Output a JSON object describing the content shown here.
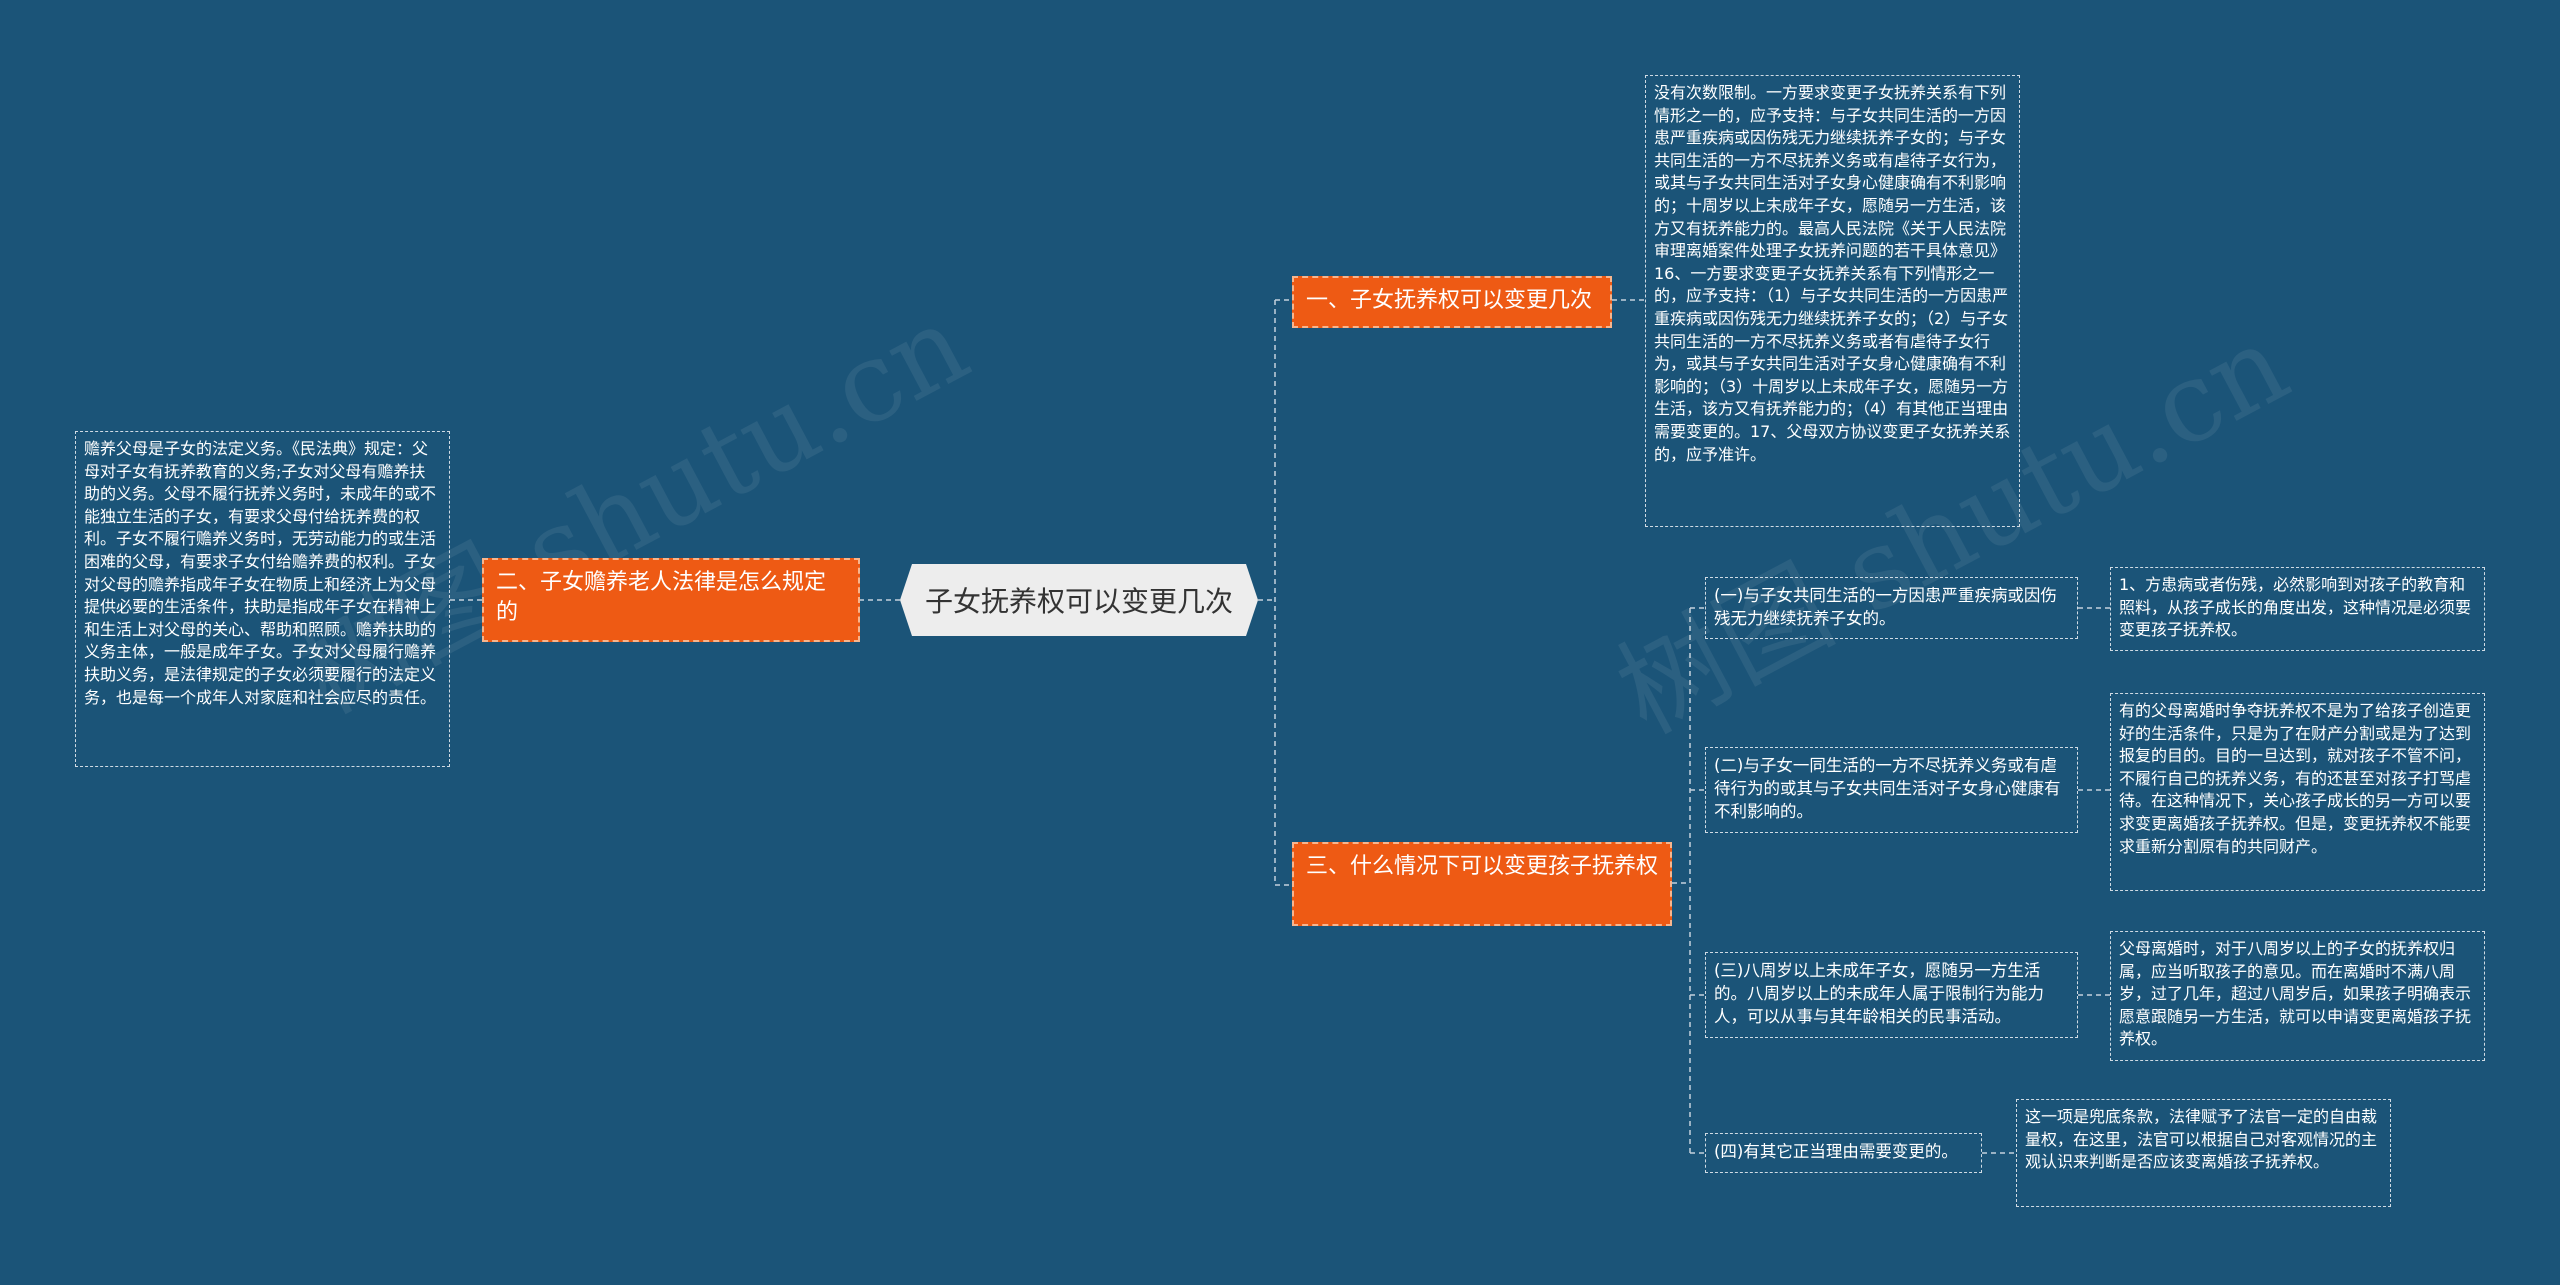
{
  "watermarks": [
    "树图 shutu.cn",
    "树图 shutu.cn"
  ],
  "root": {
    "label": "子女抚养权可以变更几次"
  },
  "left_branch": {
    "label": "二、子女赡养老人法律是怎么规定的",
    "detail": "赡养父母是子女的法定义务。《民法典》规定：父母对子女有抚养教育的义务;子女对父母有赡养扶助的义务。父母不履行抚养义务时，未成年的或不能独立生活的子女，有要求父母付给抚养费的权利。子女不履行赡养义务时，无劳动能力的或生活困难的父母，有要求子女付给赡养费的权利。子女对父母的赡养指成年子女在物质上和经济上为父母提供必要的生活条件，扶助是指成年子女在精神上和生活上对父母的关心、帮助和照顾。赡养扶助的义务主体，一般是成年子女。子女对父母履行赡养扶助义务，是法律规定的子女必须要履行的法定义务，也是每一个成年人对家庭和社会应尽的责任。"
  },
  "branch1": {
    "label": "一、子女抚养权可以变更几次",
    "detail": "没有次数限制。一方要求变更子女抚养关系有下列情形之一的，应予支持：与子女共同生活的一方因患严重疾病或因伤残无力继续抚养子女的；与子女共同生活的一方不尽抚养义务或有虐待子女行为，或其与子女共同生活对子女身心健康确有不利影响的；十周岁以上未成年子女，愿随另一方生活，该方又有抚养能力的。最高人民法院《关于人民法院审理离婚案件处理子女抚养问题的若干具体意见》16、一方要求变更子女抚养关系有下列情形之一的，应予支持：（1）与子女共同生活的一方因患严重疾病或因伤残无力继续抚养子女的；（2）与子女共同生活的一方不尽抚养义务或者有虐待子女行为，或其与子女共同生活对子女身心健康确有不利影响的；（3）十周岁以上未成年子女，愿随另一方生活，该方又有抚养能力的；（4）有其他正当理由需要变更的。17、父母双方协议变更子女抚养关系的，应予准许。"
  },
  "branch3": {
    "label": "三、什么情况下可以变更孩子抚养权",
    "items": [
      {
        "label": "(一)与子女共同生活的一方因患严重疾病或因伤残无力继续抚养子女的。",
        "detail": "1、方患病或者伤残，必然影响到对孩子的教育和照料，从孩子成长的角度出发，这种情况是必须要变更孩子抚养权。"
      },
      {
        "label": "(二)与子女一同生活的一方不尽抚养义务或有虐待行为的或其与子女共同生活对子女身心健康有不利影响的。",
        "detail": "有的父母离婚时争夺抚养权不是为了给孩子创造更好的生活条件，只是为了在财产分割或是为了达到报复的目的。目的一旦达到，就对孩子不管不问，不履行自己的抚养义务，有的还甚至对孩子打骂虐待。在这种情况下，关心孩子成长的另一方可以要求变更离婚孩子抚养权。但是，变更抚养权不能要求重新分割原有的共同财产。"
      },
      {
        "label": "(三)八周岁以上未成年子女，愿随另一方生活的。八周岁以上的未成年人属于限制行为能力人，可以从事与其年龄相关的民事活动。",
        "detail": "父母离婚时，对于八周岁以上的子女的抚养权归属，应当听取孩子的意见。而在离婚时不满八周岁，过了几年，超过八周岁后，如果孩子明确表示愿意跟随另一方生活，就可以申请变更离婚孩子抚养权。"
      },
      {
        "label": "(四)有其它正当理由需要变更的。",
        "detail": "这一项是兜底条款，法律赋予了法官一定的自由裁量权，在这里，法官可以根据自己对客观情况的主观认识来判断是否应该变离婚孩子抚养权。"
      }
    ]
  },
  "colors": {
    "background": "#1b5478",
    "branch_fill": "#ee5a14",
    "root_fill": "#ededed",
    "connector": "#c4d2dd"
  }
}
